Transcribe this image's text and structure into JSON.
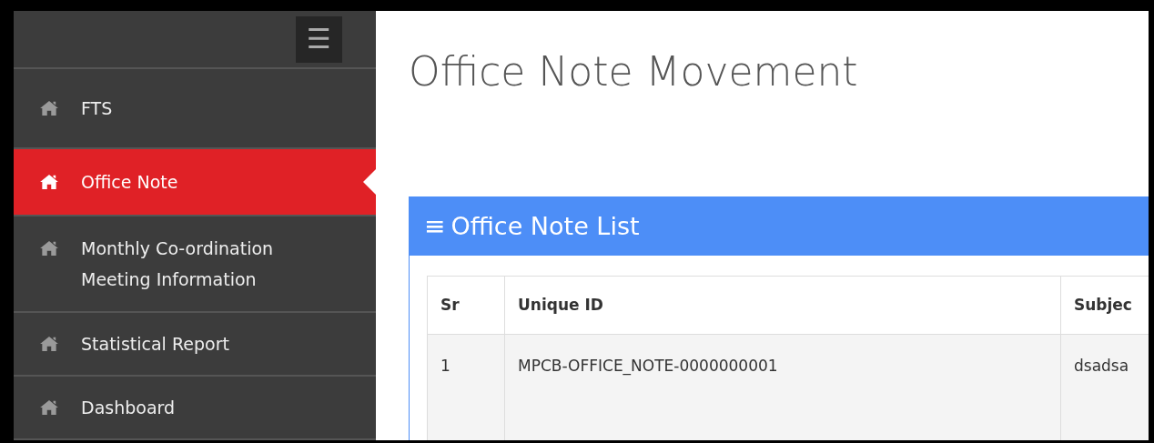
{
  "sidebar": {
    "menu_icon": "☰",
    "items": [
      {
        "label": "FTS",
        "selected": false
      },
      {
        "label": "Office Note",
        "selected": true
      },
      {
        "label": "Monthly Co-ordination Meeting Information",
        "selected": false
      },
      {
        "label": "Statistical Report",
        "selected": false
      },
      {
        "label": "Dashboard",
        "selected": false
      }
    ]
  },
  "page_title": "Office Note Movement",
  "panel": {
    "icon": "≡",
    "title": "Office Note List",
    "table": {
      "columns": [
        "Sr",
        "Unique ID",
        "Subjec"
      ],
      "rows": [
        [
          "1",
          "MPCB-OFFICE_NOTE-0000000001",
          "dsadsa"
        ]
      ]
    }
  }
}
